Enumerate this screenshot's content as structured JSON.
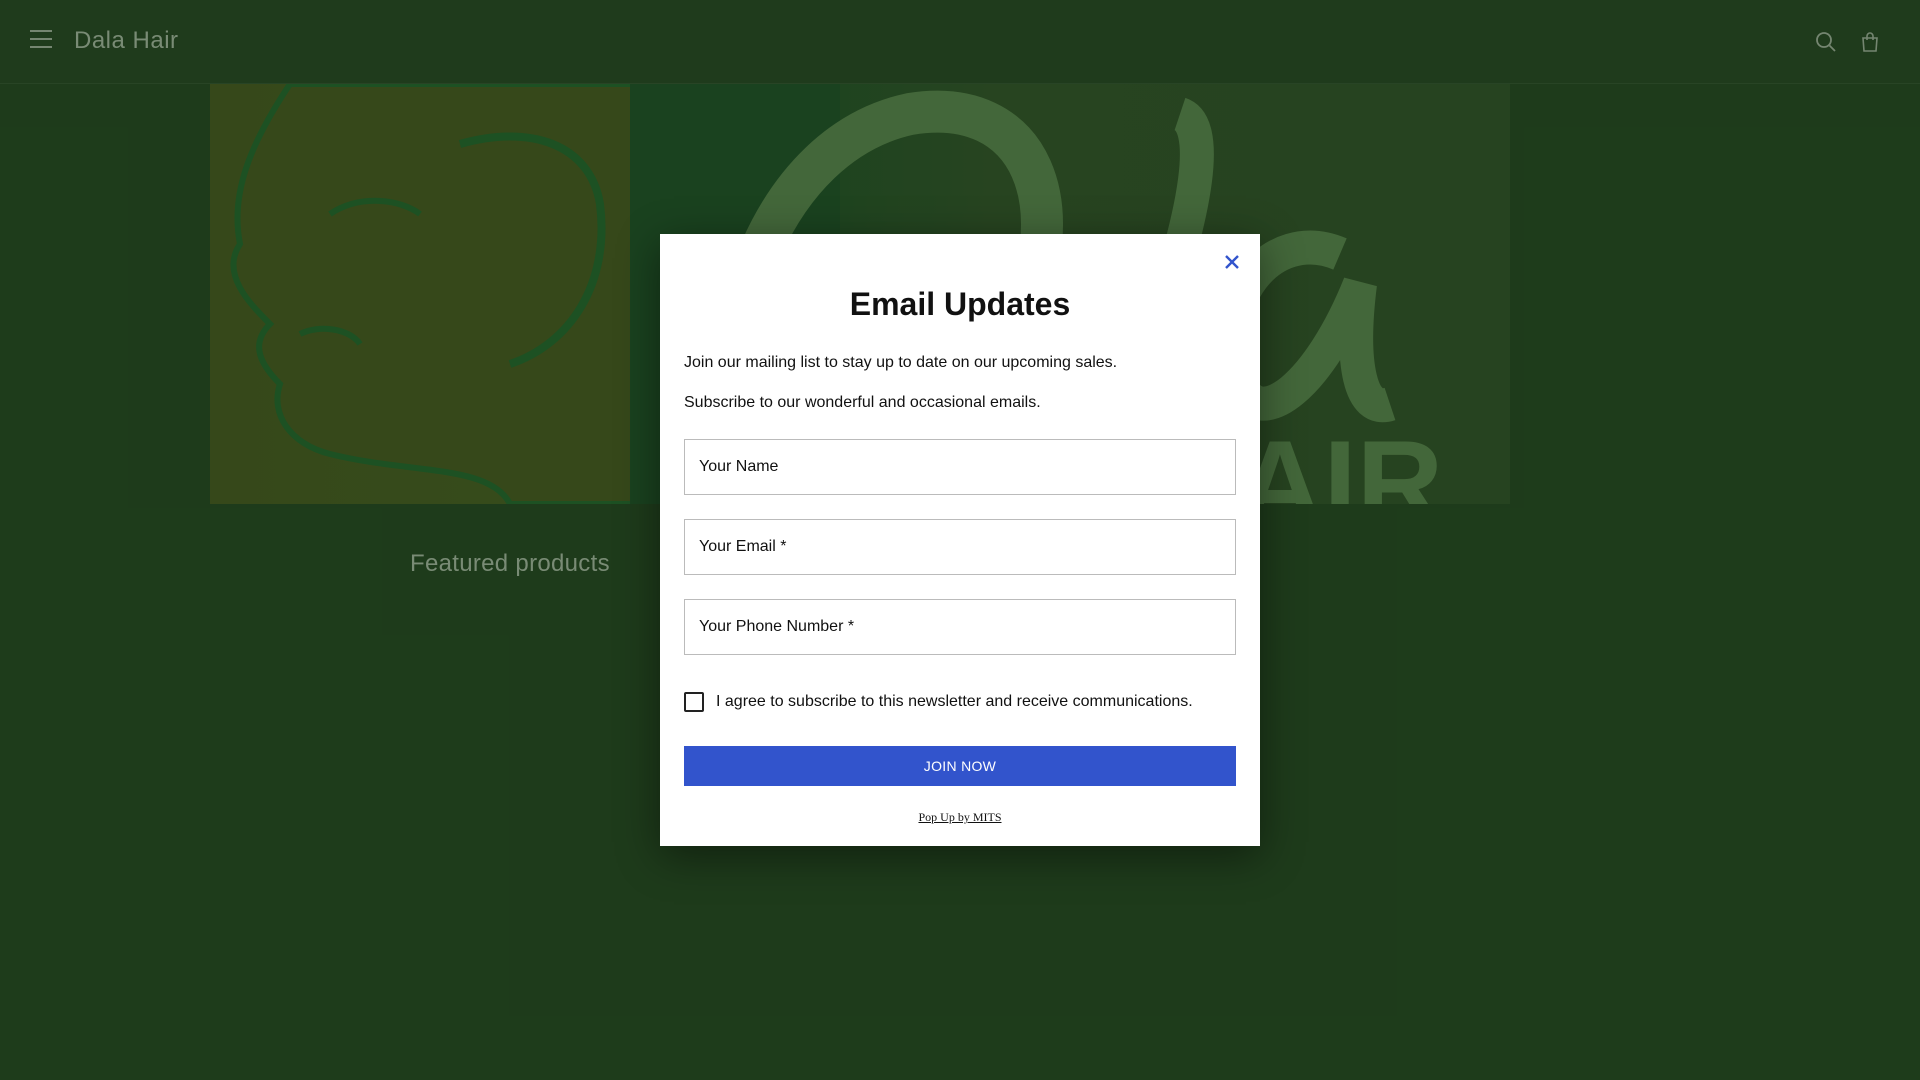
{
  "header": {
    "brand": "Dala Hair",
    "menu_icon": "hamburger-menu-icon",
    "search_icon": "search-icon",
    "cart_icon": "shopping-bag-icon"
  },
  "hero": {
    "logo_text": "Dala",
    "logo_subtext": "HAIR"
  },
  "main": {
    "featured_title": "Featured products"
  },
  "popup": {
    "title": "Email Updates",
    "description_1": "Join our mailing list to stay up to date on our upcoming sales.",
    "description_2": "Subscribe to our wonderful and occasional emails.",
    "name_placeholder": "Your Name",
    "email_placeholder": "Your Email *",
    "phone_placeholder": "Your Phone Number *",
    "consent_label": "I agree to subscribe to this newsletter and receive communications.",
    "consent_checked": false,
    "join_button": "JOIN NOW",
    "powered_by": "Pop Up by MITS",
    "accent_color": "#3254cc",
    "close_icon": "close-icon"
  },
  "colors": {
    "page_background": "#203f1d",
    "brand_text": "#8fa08a"
  }
}
